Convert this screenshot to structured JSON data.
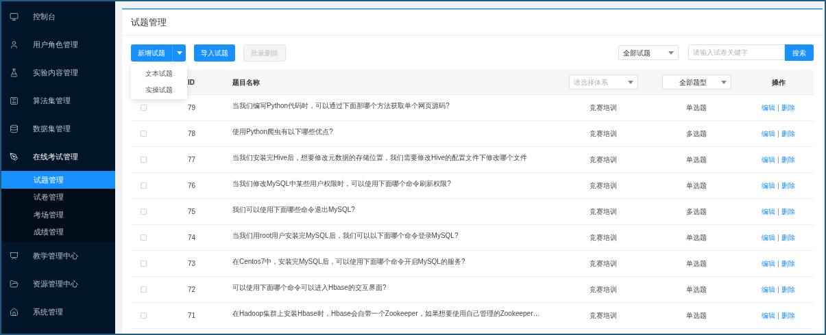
{
  "sidebar": {
    "items": [
      {
        "label": "控制台",
        "selected": false
      },
      {
        "label": "用户角色管理",
        "selected": false
      },
      {
        "label": "实验内容管理",
        "selected": false
      },
      {
        "label": "算法集管理",
        "selected": false
      },
      {
        "label": "数据集管理",
        "selected": false
      },
      {
        "label": "在线考试管理",
        "selected": false,
        "expanded": true,
        "children": [
          {
            "label": "试题管理",
            "selected": true
          },
          {
            "label": "试卷管理",
            "selected": false
          },
          {
            "label": "考场管理",
            "selected": false
          },
          {
            "label": "成绩管理",
            "selected": false
          }
        ]
      },
      {
        "label": "教学管理中心",
        "selected": false
      },
      {
        "label": "资源管理中心",
        "selected": false
      },
      {
        "label": "系统管理",
        "selected": false
      }
    ]
  },
  "page_title": "试题管理",
  "toolbar": {
    "add_button": {
      "label": "新增试题",
      "expanded": true,
      "menu": [
        "文本试题",
        "实操试题"
      ]
    },
    "import_button": {
      "label": "导入试题"
    },
    "batch_delete_button": {
      "label": "批量删除",
      "disabled": true
    },
    "filter_select": {
      "value": "全部试题"
    },
    "search": {
      "placeholder": "请输入试卷关键字"
    },
    "search_button": {
      "label": "搜索"
    }
  },
  "table": {
    "columns": [
      {
        "kind": "checkbox"
      },
      {
        "kind": "text",
        "label": "ID"
      },
      {
        "kind": "text",
        "label": "题目名称"
      },
      {
        "kind": "select",
        "placeholder": "请选择体系"
      },
      {
        "kind": "select",
        "value": "全部题型"
      },
      {
        "kind": "text",
        "label": "操作"
      }
    ],
    "action_separator": "|",
    "rows": [
      {
        "checked": false,
        "id": "79",
        "title": "当我们编写Python代码时，可以通过下面那哪个方法获取单个网页源码?",
        "system": "竞赛培训",
        "type": "单选题",
        "actions": [
          "编辑",
          "删除"
        ]
      },
      {
        "checked": false,
        "id": "78",
        "title": "使用Python爬虫有以下哪些优点?",
        "system": "竞赛培训",
        "type": "多选题",
        "actions": [
          "编辑",
          "删除"
        ]
      },
      {
        "checked": false,
        "id": "77",
        "title": "当我们安装完Hive后，想要修改元数据的存储位置，我们需要修改Hive的配置文件下修改哪个文件",
        "system": "竞赛培训",
        "type": "单选题",
        "actions": [
          "编辑",
          "删除"
        ]
      },
      {
        "checked": false,
        "id": "76",
        "title": "当我们修改MySQL中某些用户权限时，可以使用下面哪个命令刷新权限?",
        "system": "竞赛培训",
        "type": "单选题",
        "actions": [
          "编辑",
          "删除"
        ]
      },
      {
        "checked": false,
        "id": "75",
        "title": "我们可以使用下面哪些命令退出MySQL?",
        "system": "竞赛培训",
        "type": "多选题",
        "actions": [
          "编辑",
          "删除"
        ]
      },
      {
        "checked": false,
        "id": "74",
        "title": "当我们用root用户安装完MySQL后，我们可以以下面哪个命令登录MySQL?",
        "system": "竞赛培训",
        "type": "单选题",
        "actions": [
          "编辑",
          "删除"
        ]
      },
      {
        "checked": false,
        "id": "73",
        "title": "在Centos7中，安装完MySQL后，可以使用下面哪个命令开启MySQL的服务?",
        "system": "竞赛培训",
        "type": "单选题",
        "actions": [
          "编辑",
          "删除"
        ]
      },
      {
        "checked": false,
        "id": "72",
        "title": "可以使用下面哪个命令可以进入Hbase的交互界面?",
        "system": "竞赛培训",
        "type": "单选题",
        "actions": [
          "编辑",
          "删除"
        ]
      },
      {
        "checked": false,
        "id": "71",
        "title": "在Hadoop集群上安装Hbase时，Hbase会自带一个Zookeeper，如果想要使用自己管理的Zookeeper…",
        "system": "竞赛培训",
        "type": "单选题",
        "actions": [
          "编辑",
          "删除"
        ]
      }
    ]
  }
}
